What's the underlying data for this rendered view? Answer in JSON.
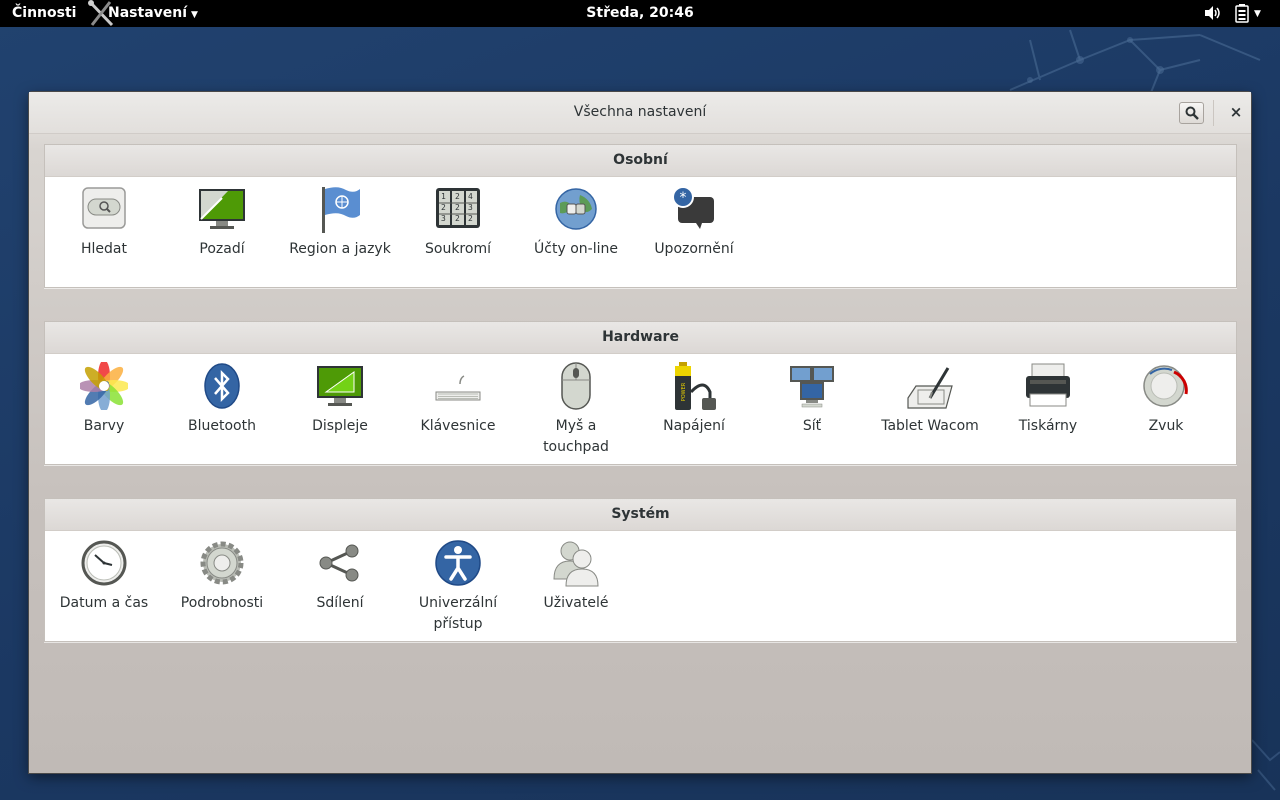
{
  "topbar": {
    "activities": "Činnosti",
    "app_menu": "Nastavení",
    "clock": "Středa, 20:46",
    "icons": [
      "volume-icon",
      "battery-icon"
    ]
  },
  "window": {
    "title": "Všechna nastavení",
    "search_icon": "search-icon",
    "close_label": "×"
  },
  "sections": [
    {
      "title": "Osobní",
      "items": [
        {
          "label": "Hledat",
          "icon": "search-settings-icon"
        },
        {
          "label": "Pozadí",
          "icon": "background-icon"
        },
        {
          "label": "Region a jazyk",
          "icon": "region-flag-icon"
        },
        {
          "label": "Soukromí",
          "icon": "privacy-icon"
        },
        {
          "label": "Účty on-line",
          "icon": "online-accounts-icon"
        },
        {
          "label": "Upozornění",
          "icon": "notifications-icon"
        }
      ]
    },
    {
      "title": "Hardware",
      "items": [
        {
          "label": "Barvy",
          "icon": "color-icon"
        },
        {
          "label": "Bluetooth",
          "icon": "bluetooth-icon"
        },
        {
          "label": "Displeje",
          "icon": "displays-icon"
        },
        {
          "label": "Klávesnice",
          "icon": "keyboard-icon"
        },
        {
          "label": "Myš a touchpad",
          "icon": "mouse-icon"
        },
        {
          "label": "Napájení",
          "icon": "power-icon"
        },
        {
          "label": "Síť",
          "icon": "network-icon"
        },
        {
          "label": "Tablet Wacom",
          "icon": "wacom-tablet-icon"
        },
        {
          "label": "Tiskárny",
          "icon": "printer-icon"
        },
        {
          "label": "Zvuk",
          "icon": "sound-icon"
        }
      ]
    },
    {
      "title": "Systém",
      "items": [
        {
          "label": "Datum a čas",
          "icon": "clock-icon"
        },
        {
          "label": "Podrobnosti",
          "icon": "gear-icon"
        },
        {
          "label": "Sdílení",
          "icon": "sharing-icon"
        },
        {
          "label": "Univerzální přístup",
          "icon": "accessibility-icon"
        },
        {
          "label": "Uživatelé",
          "icon": "users-icon"
        }
      ]
    }
  ]
}
